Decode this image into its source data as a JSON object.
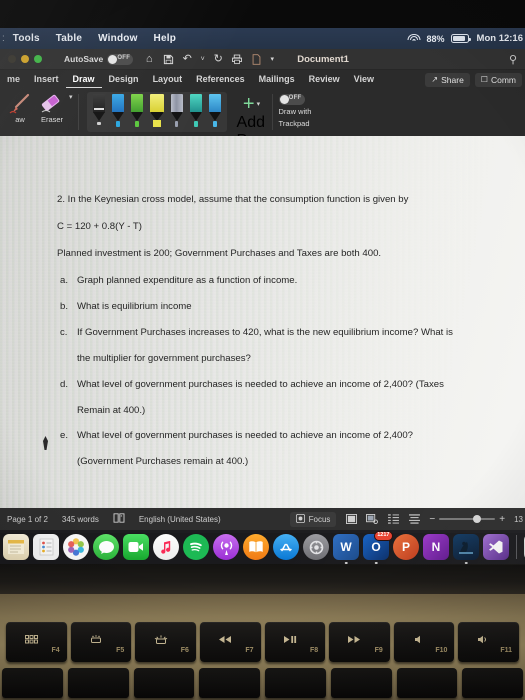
{
  "macbar": {
    "menus": [
      "Tools",
      "Table",
      "Window",
      "Help"
    ],
    "battery_percent": "88%",
    "clock": "Mon 12:16 ",
    "wifi_icon": "wifi-icon",
    "battery_icon": "battery-icon"
  },
  "word": {
    "titlebar": {
      "autosave_label": "AutoSave",
      "autosave_state": "OFF",
      "document_title": "Document1",
      "quick_access": [
        {
          "name": "home-icon",
          "glyph": "⌂"
        },
        {
          "name": "save-icon",
          "glyph": "὚B"
        },
        {
          "name": "undo-icon",
          "glyph": "↶"
        },
        {
          "name": "undo-chevron-icon",
          "glyph": "˅"
        },
        {
          "name": "redo-icon",
          "glyph": "↻"
        },
        {
          "name": "print-icon",
          "glyph": "⎙"
        },
        {
          "name": "new-document-icon",
          "glyph": "὜B"
        },
        {
          "name": "overflow-chevron-icon",
          "glyph": "˅"
        }
      ],
      "search_icon": "search-icon"
    },
    "tabs": [
      {
        "label": "me",
        "active": false
      },
      {
        "label": "Insert",
        "active": false
      },
      {
        "label": "Draw",
        "active": true
      },
      {
        "label": "Design",
        "active": false
      },
      {
        "label": "Layout",
        "active": false
      },
      {
        "label": "References",
        "active": false
      },
      {
        "label": "Mailings",
        "active": false
      },
      {
        "label": "Review",
        "active": false
      },
      {
        "label": "View",
        "active": false
      }
    ],
    "share_label": "Share",
    "comments_label": "Comm",
    "ribbon": {
      "draw_tool_label": "aw",
      "eraser_tool_label": "Eraser",
      "pens": [
        {
          "name": "pen-black",
          "color": "#1d1d1d",
          "type": "pen"
        },
        {
          "name": "pen-blue",
          "color": "#2aa7e0",
          "type": "pen"
        },
        {
          "name": "pen-green",
          "color": "#5cc73f",
          "type": "pen"
        },
        {
          "name": "highlighter-yellow",
          "color": "#e8e24a",
          "type": "highlighter"
        },
        {
          "name": "pencil-gray",
          "color": "#a9adbb",
          "type": "pencil"
        },
        {
          "name": "pen-teal",
          "color": "#3fc9b5",
          "type": "pen"
        },
        {
          "name": "pen-cyan",
          "color": "#49b7e8",
          "type": "pen"
        }
      ],
      "add_pen_label": "Add Pen",
      "add_pen_icon": "plus-icon",
      "trackpad_toggle_state": "OFF",
      "trackpad_label_line1": "Draw with",
      "trackpad_label_line2": "Trackpad"
    }
  },
  "document": {
    "question_number": "2.",
    "intro": "2. In the Keynesian cross model, assume that the consumption function is given by",
    "formula": "C = 120 + 0.8(Y - T)",
    "givens": "Planned investment is 200; Government Purchases and Taxes are both 400.",
    "items": [
      {
        "marker": "a.",
        "line1": "Graph planned expenditure as a function of income.",
        "line2": ""
      },
      {
        "marker": "b.",
        "line1": "What is equilibrium income",
        "line2": ""
      },
      {
        "marker": "c.",
        "line1": "If Government Purchases increases to 420, what is the new equilibrium income? What is",
        "line2": "the multiplier for government purchases?"
      },
      {
        "marker": "d.",
        "line1": "What level of government purchases is needed to achieve an income of 2,400? (Taxes",
        "line2": "Remain at 400.)"
      },
      {
        "marker": "e.",
        "line1": "What level of government purchases is needed to achieve an income of 2,400?",
        "line2": "(Government Purchases remain at 400.)"
      }
    ]
  },
  "statusbar": {
    "page": "Page 1 of 2",
    "words": "345 words",
    "proofing_icon": "proofing-icon",
    "language": "English (United States)",
    "focus_label": "Focus",
    "zoom_level": "13",
    "zoom_out": "−",
    "zoom_in": "+",
    "view_icons": [
      "print-layout-icon",
      "web-layout-icon",
      "outline-icon",
      "draft-icon"
    ]
  },
  "dock": {
    "items": [
      {
        "name": "dock-notes",
        "label": "",
        "color": "#f4ecd8",
        "shape": "square",
        "running": false
      },
      {
        "name": "dock-contacts",
        "label": "",
        "color": "#f2f2f2",
        "shape": "square",
        "running": false
      },
      {
        "name": "dock-photos",
        "label": "",
        "color": "#f5f5f5",
        "shape": "round",
        "running": false
      },
      {
        "name": "dock-messages",
        "label": "",
        "color": "#34c759",
        "shape": "round",
        "running": false
      },
      {
        "name": "dock-facetime",
        "label": "",
        "color": "#34c759",
        "shape": "round",
        "running": false
      },
      {
        "name": "dock-music",
        "label": "",
        "color": "#fa2b56",
        "shape": "round",
        "running": false
      },
      {
        "name": "dock-spotify",
        "label": "",
        "color": "#1db954",
        "shape": "round",
        "running": false
      },
      {
        "name": "dock-podcasts",
        "label": "",
        "color": "#b150e2",
        "shape": "round",
        "running": false
      },
      {
        "name": "dock-books",
        "label": "",
        "color": "#ff9500",
        "shape": "round",
        "running": false
      },
      {
        "name": "dock-app-store",
        "label": "",
        "color": "#1e8fe1",
        "shape": "round",
        "running": false
      },
      {
        "name": "dock-system-preferences",
        "label": "",
        "color": "#8e8e93",
        "shape": "round",
        "running": false
      },
      {
        "name": "dock-word",
        "label": "W",
        "color": "#2b579a",
        "shape": "square",
        "running": true
      },
      {
        "name": "dock-outlook",
        "label": "O",
        "color": "#0a2d6e",
        "shape": "square",
        "running": true,
        "badge": "1217"
      },
      {
        "name": "dock-powerpoint",
        "label": "P",
        "color": "#d24726",
        "shape": "square",
        "running": false
      },
      {
        "name": "dock-onenote",
        "label": "N",
        "color": "#7719aa",
        "shape": "square",
        "running": false
      },
      {
        "name": "dock-kindle",
        "label": "",
        "color": "#0b1c33",
        "shape": "square",
        "running": true
      },
      {
        "name": "dock-visual-studio",
        "label": "",
        "color": "#5c2d91",
        "shape": "square",
        "running": false
      },
      {
        "name": "dock-document-stack",
        "label": "",
        "color": "#e8e8e8",
        "shape": "square",
        "running": true
      },
      {
        "name": "dock-preview-image",
        "label": "",
        "color": "#a9c3d8",
        "shape": "square",
        "running": false
      }
    ]
  },
  "keyboard": {
    "keys": [
      {
        "fkey": "F4",
        "glyph": "grid",
        "name": "key-f4-launchpad"
      },
      {
        "fkey": "F5",
        "glyph": "···",
        "name": "key-f5-keyboard-brightness-down"
      },
      {
        "fkey": "F6",
        "glyph": "☀",
        "name": "key-f6-keyboard-brightness-up"
      },
      {
        "fkey": "F7",
        "glyph": "◀◀",
        "name": "key-f7-rewind"
      },
      {
        "fkey": "F8",
        "glyph": "▶❙❙",
        "name": "key-f8-play-pause"
      },
      {
        "fkey": "F9",
        "glyph": "▶▶",
        "name": "key-f9-fast-forward"
      },
      {
        "fkey": "F10",
        "glyph": "◂",
        "name": "key-f10-mute"
      },
      {
        "fkey": "F11",
        "glyph": "◂))",
        "name": "key-f11-volume-down"
      }
    ]
  }
}
